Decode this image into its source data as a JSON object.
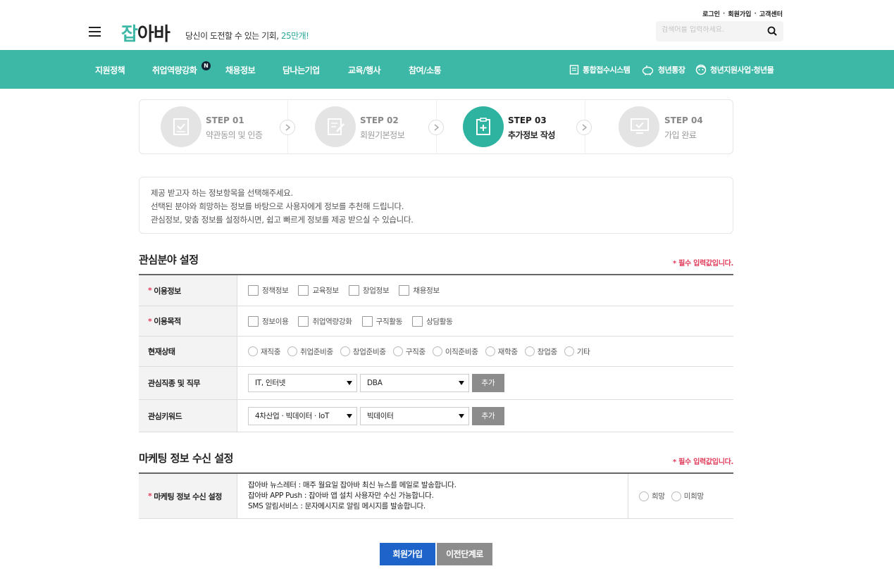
{
  "header": {
    "logo_accent": "잡",
    "logo_rest": "아바",
    "tagline_main": "당신이 도전할 수 있는 기회, ",
    "tagline_highlight": "25만개!",
    "util_links": [
      "로그인",
      "회원가입",
      "고객센터"
    ],
    "util_separator": "·",
    "search_placeholder": "검색어를 입력하세요."
  },
  "nav": {
    "items": [
      "지원정책",
      "취업역량강화",
      "채용정보",
      "담나는기업",
      "교육/행사",
      "참여/소통"
    ],
    "new_badge": "N",
    "right_items": [
      {
        "label": "통합접수시스템",
        "icon": "document-icon"
      },
      {
        "label": "청년통장",
        "icon": "piggy-bank-icon"
      },
      {
        "label": "청년지원사업·청년몰",
        "icon": "face-icon"
      }
    ]
  },
  "steps": [
    {
      "num": "STEP 01",
      "label": "약관동의 및 인증",
      "active": false
    },
    {
      "num": "STEP 02",
      "label": "회원기본정보",
      "active": false
    },
    {
      "num": "STEP 03",
      "label": "추가정보 작성",
      "active": true
    },
    {
      "num": "STEP 04",
      "label": "가입 완료",
      "active": false
    }
  ],
  "info": {
    "lines": [
      "제공 받고자 하는 정보항목을 선택해주세요.",
      "선택된 분야와 희망하는 정보를 바탕으로 사용자에게 정보를 추천해 드립니다.",
      "관심정보, 맞춤 정보를 설정하시면, 쉽고 빠르게 정보를 제공 받으실 수 있습니다."
    ]
  },
  "interest": {
    "title": "관심분야 설정",
    "required_note": "* 필수 입력값입니다.",
    "rows": {
      "usage_info": {
        "label": "이용정보",
        "required": "*",
        "options": [
          "정책정보",
          "교육정보",
          "창업정보",
          "채용정보"
        ]
      },
      "usage_purpose": {
        "label": "이용목적",
        "required": "*",
        "options": [
          "정보이용",
          "취업역량강화",
          "구직활동",
          "상담활동"
        ]
      },
      "status": {
        "label": "현재상태",
        "options": [
          "재직중",
          "취업준비중",
          "창업준비중",
          "구직중",
          "이직준비중",
          "재학중",
          "창업중",
          "기타"
        ]
      },
      "job": {
        "label": "관심직종 및 직무",
        "select1": "IT, 인터넷",
        "select2": "DBA",
        "add": "추가"
      },
      "keyword": {
        "label": "관심키워드",
        "select1": "4차산업 · 빅데이터 · IoT",
        "select2": "빅데이터",
        "add": "추가"
      }
    }
  },
  "marketing": {
    "title": "마케팅 정보 수신 설정",
    "required_note": "* 필수 입력값입니다.",
    "row_label": "마케팅 정보 수신 설정",
    "required": "*",
    "lines": [
      "잡아바 뉴스레터 : 매주 월요일 잡아바 최신 뉴스를 메일로 발송합니다.",
      "잡아바 APP Push : 잡아바 앱 설치 사용자만 수신 가능합니다.",
      "SMS 알림서비스 : 문자메시지로 알림 메시지를 발송합니다."
    ],
    "options": [
      "희망",
      "미희망"
    ]
  },
  "buttons": {
    "join": "회원가입",
    "prev": "이전단계로"
  },
  "colors": {
    "brand": "#3db8a6",
    "primary_button": "#1d63c9",
    "required": "#e03b5a"
  }
}
